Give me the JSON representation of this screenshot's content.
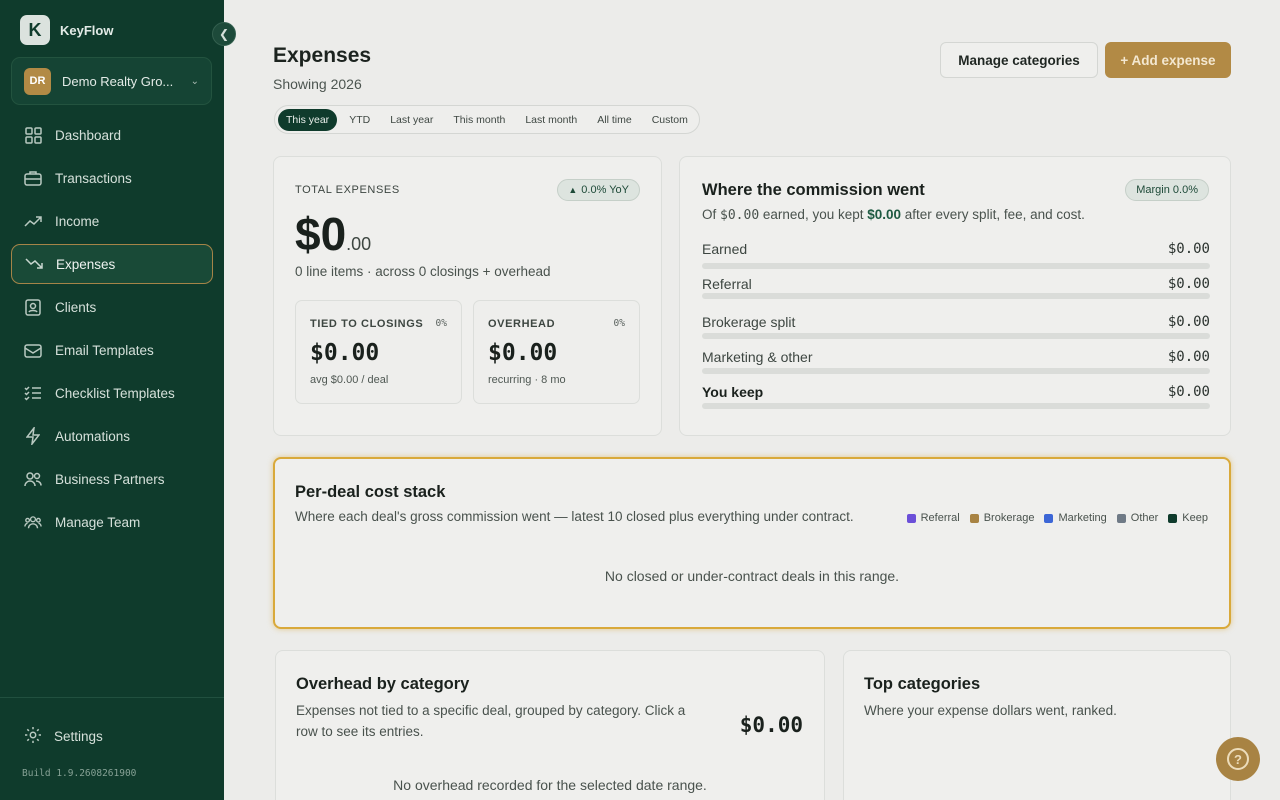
{
  "brand": {
    "name": "KeyFlow",
    "logo_letter": "K"
  },
  "org": {
    "initials": "DR",
    "name": "Demo Realty Gro..."
  },
  "nav": [
    {
      "label": "Dashboard",
      "icon": "grid-icon"
    },
    {
      "label": "Transactions",
      "icon": "briefcase-icon"
    },
    {
      "label": "Income",
      "icon": "trend-up-icon"
    },
    {
      "label": "Expenses",
      "icon": "trend-down-icon",
      "active": true
    },
    {
      "label": "Clients",
      "icon": "contacts-icon"
    },
    {
      "label": "Email Templates",
      "icon": "mail-icon"
    },
    {
      "label": "Checklist Templates",
      "icon": "checklist-icon"
    },
    {
      "label": "Automations",
      "icon": "bolt-icon"
    },
    {
      "label": "Business Partners",
      "icon": "users-icon"
    },
    {
      "label": "Manage Team",
      "icon": "team-icon"
    }
  ],
  "settings_label": "Settings",
  "build": "Build 1.9.2608261900",
  "page": {
    "title": "Expenses",
    "subtitle": "Showing 2026"
  },
  "buttons": {
    "manage": "Manage categories",
    "add": "+ Add expense"
  },
  "ranges": [
    "This year",
    "YTD",
    "Last year",
    "This month",
    "Last month",
    "All time",
    "Custom"
  ],
  "active_range": "This year",
  "total": {
    "label": "TOTAL EXPENSES",
    "yoy": "0.0% YoY",
    "amount_main": "$0",
    "amount_cents": ".00",
    "subtitle": "0 line items · across 0 closings + overhead",
    "tied": {
      "label": "TIED TO CLOSINGS",
      "pct": "0%",
      "value": "$0.00",
      "note": "avg $0.00 / deal"
    },
    "overhead": {
      "label": "OVERHEAD",
      "pct": "0%",
      "value": "$0.00",
      "note": "recurring · 8 mo"
    }
  },
  "commission": {
    "title": "Where the commission went",
    "margin": "Margin 0.0%",
    "sub_pre": "Of ",
    "sub_earned": "$0.00",
    "sub_mid": " earned, you kept ",
    "sub_kept": "$0.00",
    "sub_post": " after every split, fee, and cost.",
    "rows": [
      {
        "name": "Earned",
        "amount": "$0.00"
      },
      {
        "name": "Referral",
        "amount": "$0.00"
      },
      {
        "name": "Brokerage split",
        "amount": "$0.00"
      },
      {
        "name": "Marketing & other",
        "amount": "$0.00"
      },
      {
        "name": "You keep",
        "amount": "$0.00"
      }
    ]
  },
  "stack": {
    "title": "Per-deal cost stack",
    "subtitle": "Where each deal's gross commission went — latest 10 closed plus everything under contract.",
    "legend": [
      {
        "label": "Referral",
        "color": "#6b4fd8"
      },
      {
        "label": "Brokerage",
        "color": "#a88343"
      },
      {
        "label": "Marketing",
        "color": "#3c66d6"
      },
      {
        "label": "Other",
        "color": "#6f7a86"
      },
      {
        "label": "Keep",
        "color": "#0f3b2c"
      }
    ],
    "empty": "No closed or under-contract deals in this range."
  },
  "overhead_section": {
    "title": "Overhead by category",
    "subtitle_line1": "Expenses not tied to a specific deal, grouped by category. Click a",
    "subtitle_line2": "row to see its entries.",
    "total": "$0.00",
    "empty": "No overhead recorded for the selected date range."
  },
  "top_categories": {
    "title": "Top categories",
    "subtitle": "Where your expense dollars went, ranked."
  }
}
